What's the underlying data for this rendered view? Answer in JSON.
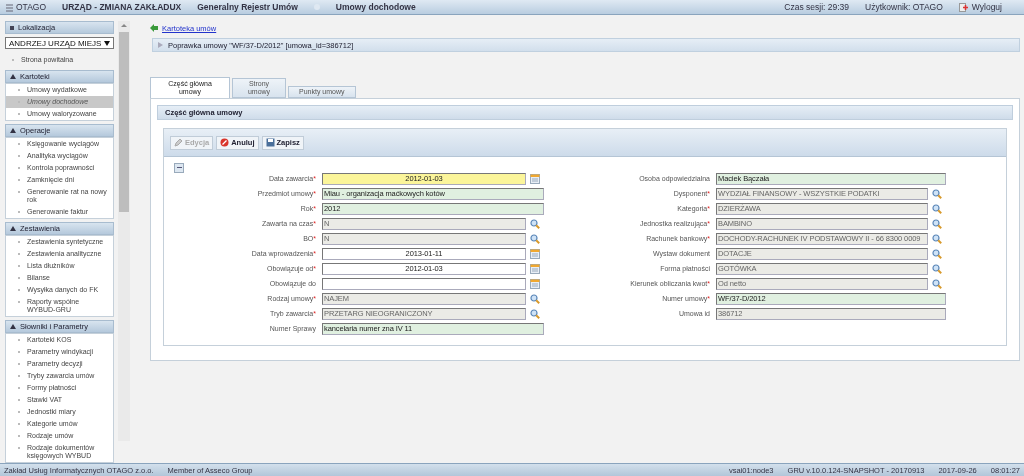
{
  "header": {
    "app": "OTAGO",
    "unit": "URZĄD - ZMIANA ZAKŁADUX",
    "module": "Generalny Rejestr Umów",
    "page": "Umowy dochodowe",
    "session": "Czas sesji:  29:39",
    "user": "Użytkownik: OTAGO",
    "logout": "Wyloguj"
  },
  "sidebar": {
    "location": {
      "title": "Lokalizacja",
      "value": "ANDRZEJ URZĄD MIEJS"
    },
    "home": "Strona powitalna",
    "sections": [
      {
        "title": "Kartoteki",
        "expanded": true,
        "items": [
          {
            "label": "Umowy wydatkowe",
            "selected": false
          },
          {
            "label": "Umowy dochodowe",
            "selected": true
          },
          {
            "label": "Umowy waloryzowane",
            "selected": false
          }
        ]
      },
      {
        "title": "Operacje",
        "expanded": true,
        "items": [
          {
            "label": "Księgowanie wyciągów",
            "selected": false
          },
          {
            "label": "Analityka wyciągów",
            "selected": false
          },
          {
            "label": "Kontrola poprawności",
            "selected": false
          },
          {
            "label": "Zamknięcie dni",
            "selected": false
          },
          {
            "label": "Generowanie rat na nowy rok",
            "selected": false
          },
          {
            "label": "Generowanie faktur",
            "selected": false
          }
        ]
      },
      {
        "title": "Zestawienia",
        "expanded": true,
        "items": [
          {
            "label": "Zestawienia syntetyczne",
            "selected": false
          },
          {
            "label": "Zestawienia analityczne",
            "selected": false
          },
          {
            "label": "Lista dłużników",
            "selected": false
          },
          {
            "label": "Bilanse",
            "selected": false
          },
          {
            "label": "Wysyłka danych do FK",
            "selected": false
          },
          {
            "label": "Raporty wspólne WYBUD-GRU",
            "selected": false
          }
        ]
      },
      {
        "title": "Słowniki i Parametry",
        "expanded": true,
        "items": [
          {
            "label": "Kartoteki KOS",
            "selected": false
          },
          {
            "label": "Parametry windykacji",
            "selected": false
          },
          {
            "label": "Parametry decyzji",
            "selected": false
          },
          {
            "label": "Tryby zawarcia umów",
            "selected": false
          },
          {
            "label": "Formy płatności",
            "selected": false
          },
          {
            "label": "Stawki VAT",
            "selected": false
          },
          {
            "label": "Jednostki miary",
            "selected": false
          },
          {
            "label": "Kategorie umów",
            "selected": false
          },
          {
            "label": "Rodzaje umów",
            "selected": false
          },
          {
            "label": "Rodzaje dokumentów księgowych WYBUD",
            "selected": false
          }
        ]
      }
    ]
  },
  "breadcrumb": "Kartoteka umów",
  "title": "Poprawka umowy \"WF/37-D/2012\" [umowa_id=386712]",
  "tabs": [
    {
      "label": "Część główna\numowy",
      "selected": true
    },
    {
      "label": "Strony\numowy",
      "selected": false
    },
    {
      "label": "Punkty umowy",
      "selected": false
    }
  ],
  "section_title": "Część główna umowy",
  "toolbar": [
    {
      "kind": "edit",
      "label": "Edycja",
      "disabled": true
    },
    {
      "kind": "cancel",
      "label": "Anuluj",
      "disabled": false
    },
    {
      "kind": "save",
      "label": "Zapisz",
      "disabled": false
    }
  ],
  "form_left": [
    {
      "label": "Data zawarcia",
      "mark": "*",
      "kind": "date",
      "value": "2012-01-03",
      "focused": true
    },
    {
      "label": "Przedmiot umowy",
      "mark": "*",
      "kind": "text",
      "value": "Miau - organizacja maćkowych kotów",
      "focused": false
    },
    {
      "label": "Rok",
      "mark": "*",
      "kind": "text",
      "value": "2012",
      "focused": false
    },
    {
      "label": "Zawarta na czas",
      "mark": "*",
      "kind": "lookup",
      "value": "N",
      "focused": false
    },
    {
      "label": "BO",
      "mark": "*",
      "kind": "lookup",
      "value": "N",
      "focused": false
    },
    {
      "label": "Data wprowadzenia",
      "mark": "*",
      "kind": "date",
      "value": "2013-01-11",
      "focused": false
    },
    {
      "label": "Obowiązuje od",
      "mark": "*",
      "kind": "date",
      "value": "2012-01-03",
      "focused": false
    },
    {
      "label": "Obowiązuje do",
      "kind": "date",
      "focused": false
    },
    {
      "label": "Rodzaj umowy",
      "mark": "*",
      "kind": "lookup",
      "value": "NAJEM",
      "focused": false
    },
    {
      "label": "Tryb zawarcia",
      "mark": "*",
      "kind": "lookup",
      "value": "PRZETARG NIEOGRANICZONY",
      "focused": false
    },
    {
      "label": "Numer Sprawy",
      "kind": "text",
      "value": "kancelaria numer zna IV 11",
      "focused": false
    }
  ],
  "form_right": [
    {
      "label": "Osoba odpowiedzialna",
      "kind": "text",
      "value": "Maciek Bączała",
      "focused": false
    },
    {
      "label": "Dysponent",
      "mark": "*",
      "kind": "lookup",
      "value": "WYDZIAŁ FINANSOWY - WSZYSTKIE PODATKI",
      "focused": false
    },
    {
      "label": "Kategoria",
      "mark": "*",
      "kind": "lookup",
      "value": "DZIERŻAWA",
      "focused": false
    },
    {
      "label": "Jednostka realizująca",
      "mark": "*",
      "kind": "lookup",
      "value": "BAMBINO",
      "focused": false
    },
    {
      "label": "Rachunek bankowy",
      "mark": "*",
      "kind": "lookup",
      "value": "DOCHODY-RACHUNEK IV PODSTAWOWY II - 66 8300 0009",
      "focused": false
    },
    {
      "label": "Wystaw dokument",
      "kind": "lookup",
      "value": "DOTACJE",
      "focused": false
    },
    {
      "label": "Forma płatności",
      "kind": "lookup",
      "value": "GOTÓWKA",
      "focused": false
    },
    {
      "label": "Kierunek obliczania kwot",
      "mark": "*",
      "kind": "lookup",
      "value": "Od netto",
      "focused": false
    },
    {
      "label": "Numer umowy",
      "mark": "*",
      "kind": "text",
      "value": "WF/37-D/2012",
      "focused": false
    },
    {
      "label": "Umowa id",
      "kind": "readonly",
      "value": "386712",
      "focused": false
    }
  ],
  "footer": {
    "company": "Zakład Usług Informatycznych OTAGO z.o.o.",
    "group": "Member of Asseco Group",
    "node": "vsai01:node3",
    "version": "GRU v.10.0.124-SNAPSHOT - 20170913",
    "date": "2017-09-26",
    "time": "08:01:27"
  }
}
